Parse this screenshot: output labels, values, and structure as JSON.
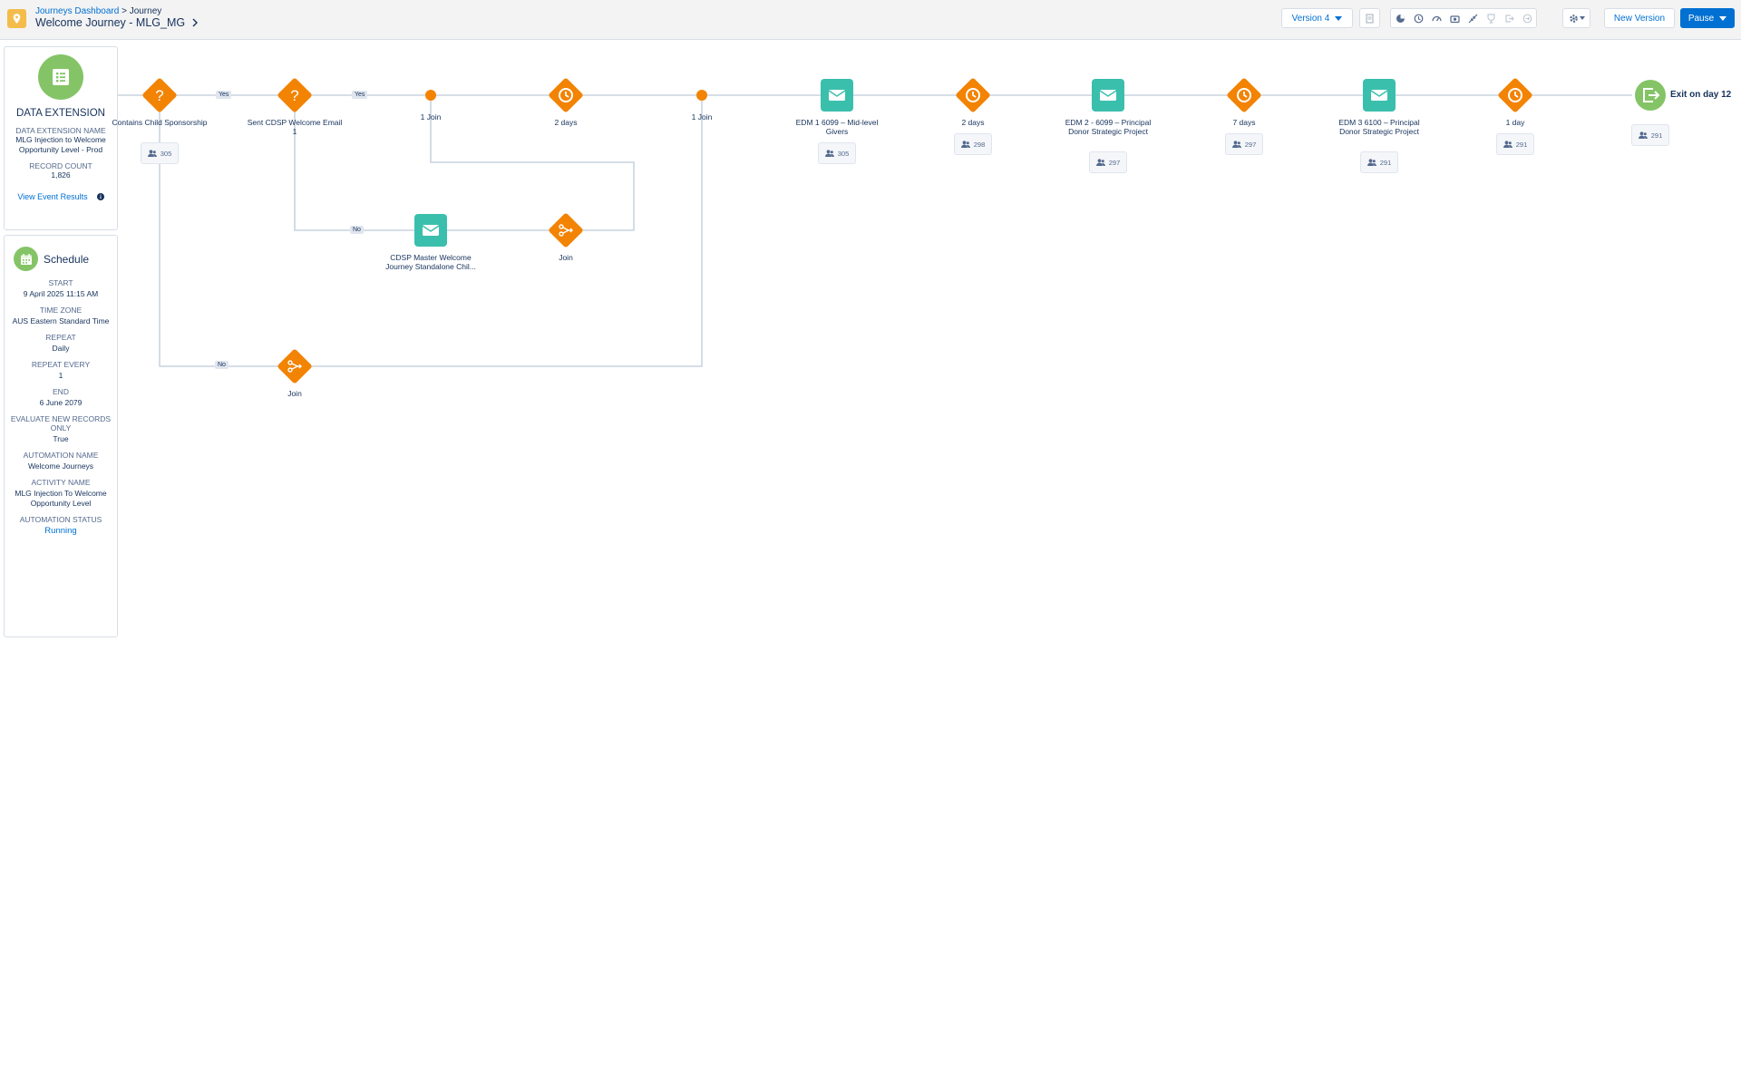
{
  "header": {
    "breadcrumb_root": "Journeys Dashboard",
    "breadcrumb_sep": ">",
    "breadcrumb_current": "Journey",
    "title": "Welcome Journey - MLG_MG",
    "version_label": "Version 4",
    "new_version_label": "New Version",
    "pause_label": "Pause",
    "toolbar_icons": [
      "notes-icon",
      "stats-icon",
      "history-icon",
      "speed-icon",
      "camera-icon",
      "collapse-icon",
      "goal-icon",
      "exit-criteria-icon",
      "exit-icon",
      "settings-icon"
    ]
  },
  "entry_source": {
    "heading": "DATA EXTENSION",
    "name_label": "DATA EXTENSION NAME",
    "name_value": "MLG Injection to Welcome Opportunity Level - Prod",
    "count_label": "RECORD COUNT",
    "count_value": "1,826",
    "link": "View Event Results"
  },
  "schedule": {
    "heading": "Schedule",
    "items": [
      {
        "label": "START",
        "value": "9 April 2025 11:15 AM"
      },
      {
        "label": "TIME ZONE",
        "value": "AUS Eastern Standard Time"
      },
      {
        "label": "REPEAT",
        "value": "Daily"
      },
      {
        "label": "REPEAT EVERY",
        "value": "1"
      },
      {
        "label": "END",
        "value": "6 June 2079"
      },
      {
        "label": "EVALUATE NEW RECORDS ONLY",
        "value": "True"
      },
      {
        "label": "AUTOMATION NAME",
        "value": "Welcome Journeys"
      },
      {
        "label": "ACTIVITY NAME",
        "value": "MLG Injection To Welcome Opportunity Level"
      },
      {
        "label": "AUTOMATION STATUS",
        "value": "Running"
      }
    ]
  },
  "journey": {
    "nodes": [
      {
        "kind": "decision",
        "label": "Contains Child Sponsorship",
        "count": "305"
      },
      {
        "kind": "decision",
        "label": "Sent CDSP Welcome Email 1",
        "count": ""
      },
      {
        "kind": "join-dot",
        "label": "1 Join",
        "count": ""
      },
      {
        "kind": "wait",
        "label": "2 days",
        "count": ""
      },
      {
        "kind": "join-dot",
        "label": "1 Join",
        "count": ""
      },
      {
        "kind": "email",
        "label": "EDM 1 6099 – Mid-level Givers",
        "count": "305"
      },
      {
        "kind": "wait",
        "label": "2 days",
        "count": "298"
      },
      {
        "kind": "email",
        "label": "EDM 2 - 6099 – Principal Donor Strategic Project",
        "count": "297"
      },
      {
        "kind": "wait",
        "label": "7 days",
        "count": "297"
      },
      {
        "kind": "email",
        "label": "EDM 3 6100 – Principal Donor Strategic Project",
        "count": "291"
      },
      {
        "kind": "wait",
        "label": "1 day",
        "count": "291"
      },
      {
        "kind": "exit",
        "label": "Exit on day 12",
        "count": "291"
      },
      {
        "kind": "email",
        "label": "CDSP Master Welcome Journey Standalone Chil...",
        "count": ""
      },
      {
        "kind": "join",
        "label": "Join",
        "count": ""
      },
      {
        "kind": "join",
        "label": "Join",
        "count": ""
      }
    ],
    "edge_tags": [
      "Yes",
      "Yes",
      "No",
      "No"
    ]
  },
  "colors": {
    "decision": "#f38303",
    "email": "#3bbfad",
    "entry": "#84c466",
    "schedule": "#84c466",
    "exit": "#84c466",
    "link": "#0070d2"
  }
}
